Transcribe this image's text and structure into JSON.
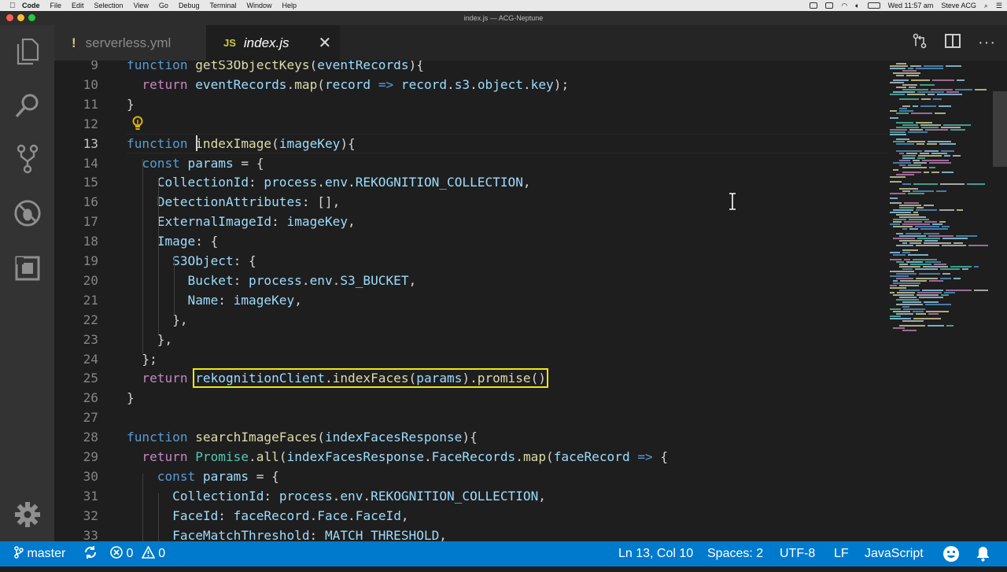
{
  "menubar": {
    "app": "Code",
    "items": [
      "File",
      "Edit",
      "Selection",
      "View",
      "Go",
      "Debug",
      "Terminal",
      "Window",
      "Help"
    ],
    "clock": "Wed 11:57 am",
    "user": "Steve ACG"
  },
  "window": {
    "title": "index.js — ACG-Neptune"
  },
  "tabs": [
    {
      "label": "serverless.yml",
      "icon": "exclamation-icon"
    },
    {
      "label": "index.js",
      "icon": "js-file-icon",
      "close": "✕"
    }
  ],
  "editor": {
    "current_line": 13,
    "lines": [
      {
        "n": "9",
        "tokens": [
          [
            "kw",
            "function "
          ],
          [
            "fn",
            "getS3ObjectKeys"
          ],
          [
            "pu",
            "("
          ],
          [
            "v",
            "eventRecords"
          ],
          [
            "pu",
            "){"
          ]
        ]
      },
      {
        "n": "10",
        "tokens": [
          [
            "kc",
            "  return "
          ],
          [
            "v",
            "eventRecords"
          ],
          [
            "pu",
            "."
          ],
          [
            "fn",
            "map"
          ],
          [
            "pu",
            "("
          ],
          [
            "v",
            "record"
          ],
          [
            "kw",
            " => "
          ],
          [
            "v",
            "record"
          ],
          [
            "pu",
            "."
          ],
          [
            "v",
            "s3"
          ],
          [
            "pu",
            "."
          ],
          [
            "v",
            "object"
          ],
          [
            "pu",
            "."
          ],
          [
            "v",
            "key"
          ],
          [
            "pu",
            ");"
          ]
        ]
      },
      {
        "n": "11",
        "tokens": [
          [
            "pu",
            "}"
          ]
        ]
      },
      {
        "n": "12",
        "tokens": []
      },
      {
        "n": "13",
        "tokens": [
          [
            "kw",
            "function "
          ],
          [
            "fn",
            "indexImage"
          ],
          [
            "pu",
            "("
          ],
          [
            "v",
            "imageKey"
          ],
          [
            "pu",
            "){"
          ]
        ]
      },
      {
        "n": "14",
        "tokens": [
          [
            "kw",
            "  const "
          ],
          [
            "v",
            "params"
          ],
          [
            "pu",
            " = {"
          ]
        ]
      },
      {
        "n": "15",
        "tokens": [
          [
            "v",
            "    CollectionId"
          ],
          [
            "pu",
            ": "
          ],
          [
            "v",
            "process"
          ],
          [
            "pu",
            "."
          ],
          [
            "v",
            "env"
          ],
          [
            "pu",
            "."
          ],
          [
            "v",
            "REKOGNITION_COLLECTION"
          ],
          [
            "pu",
            ","
          ]
        ]
      },
      {
        "n": "16",
        "tokens": [
          [
            "v",
            "    DetectionAttributes"
          ],
          [
            "pu",
            ": [],"
          ]
        ]
      },
      {
        "n": "17",
        "tokens": [
          [
            "v",
            "    ExternalImageId"
          ],
          [
            "pu",
            ": "
          ],
          [
            "v",
            "imageKey"
          ],
          [
            "pu",
            ","
          ]
        ]
      },
      {
        "n": "18",
        "tokens": [
          [
            "v",
            "    Image"
          ],
          [
            "pu",
            ": {"
          ]
        ]
      },
      {
        "n": "19",
        "tokens": [
          [
            "v",
            "      S3Object"
          ],
          [
            "pu",
            ": {"
          ]
        ]
      },
      {
        "n": "20",
        "tokens": [
          [
            "v",
            "        Bucket"
          ],
          [
            "pu",
            ": "
          ],
          [
            "v",
            "process"
          ],
          [
            "pu",
            "."
          ],
          [
            "v",
            "env"
          ],
          [
            "pu",
            "."
          ],
          [
            "v",
            "S3_BUCKET"
          ],
          [
            "pu",
            ","
          ]
        ]
      },
      {
        "n": "21",
        "tokens": [
          [
            "v",
            "        Name"
          ],
          [
            "pu",
            ": "
          ],
          [
            "v",
            "imageKey"
          ],
          [
            "pu",
            ","
          ]
        ]
      },
      {
        "n": "22",
        "tokens": [
          [
            "pu",
            "      },"
          ]
        ]
      },
      {
        "n": "23",
        "tokens": [
          [
            "pu",
            "    },"
          ]
        ]
      },
      {
        "n": "24",
        "tokens": [
          [
            "pu",
            "  };"
          ]
        ]
      },
      {
        "n": "25",
        "tokens": [
          [
            "kc",
            "  return "
          ],
          [
            "hl",
            "rekognitionClient.indexFaces(params).promise()"
          ]
        ]
      },
      {
        "n": "26",
        "tokens": [
          [
            "pu",
            "}"
          ]
        ]
      },
      {
        "n": "27",
        "tokens": []
      },
      {
        "n": "28",
        "tokens": [
          [
            "kw",
            "function "
          ],
          [
            "fn",
            "searchImageFaces"
          ],
          [
            "pu",
            "("
          ],
          [
            "v",
            "indexFacesResponse"
          ],
          [
            "pu",
            "){"
          ]
        ]
      },
      {
        "n": "29",
        "tokens": [
          [
            "kc",
            "  return "
          ],
          [
            "cls",
            "Promise"
          ],
          [
            "pu",
            "."
          ],
          [
            "fn",
            "all"
          ],
          [
            "pu",
            "("
          ],
          [
            "v",
            "indexFacesResponse"
          ],
          [
            "pu",
            "."
          ],
          [
            "v",
            "FaceRecords"
          ],
          [
            "pu",
            "."
          ],
          [
            "fn",
            "map"
          ],
          [
            "pu",
            "("
          ],
          [
            "v",
            "faceRecord"
          ],
          [
            "kw",
            " => "
          ],
          [
            "pu",
            "{"
          ]
        ]
      },
      {
        "n": "30",
        "tokens": [
          [
            "kw",
            "    const "
          ],
          [
            "v",
            "params"
          ],
          [
            "pu",
            " = {"
          ]
        ]
      },
      {
        "n": "31",
        "tokens": [
          [
            "v",
            "      CollectionId"
          ],
          [
            "pu",
            ": "
          ],
          [
            "v",
            "process"
          ],
          [
            "pu",
            "."
          ],
          [
            "v",
            "env"
          ],
          [
            "pu",
            "."
          ],
          [
            "v",
            "REKOGNITION_COLLECTION"
          ],
          [
            "pu",
            ","
          ]
        ]
      },
      {
        "n": "32",
        "tokens": [
          [
            "v",
            "      FaceId"
          ],
          [
            "pu",
            ": "
          ],
          [
            "v",
            "faceRecord"
          ],
          [
            "pu",
            "."
          ],
          [
            "v",
            "Face"
          ],
          [
            "pu",
            "."
          ],
          [
            "v",
            "FaceId"
          ],
          [
            "pu",
            ","
          ]
        ]
      },
      {
        "n": "33",
        "tokens": [
          [
            "v",
            "      FaceMatchThreshold"
          ],
          [
            "pu",
            ": "
          ],
          [
            "v",
            "MATCH_THRESHOLD"
          ],
          [
            "pu",
            ","
          ]
        ]
      }
    ]
  },
  "status": {
    "branch": "master",
    "errors": "0",
    "warnings": "0",
    "position": "Ln 13, Col 10",
    "spaces": "Spaces: 2",
    "encoding": "UTF-8",
    "eol": "LF",
    "language": "JavaScript"
  },
  "colors": {
    "accent": "#007acc",
    "highlight_box": "#f2e70c"
  }
}
